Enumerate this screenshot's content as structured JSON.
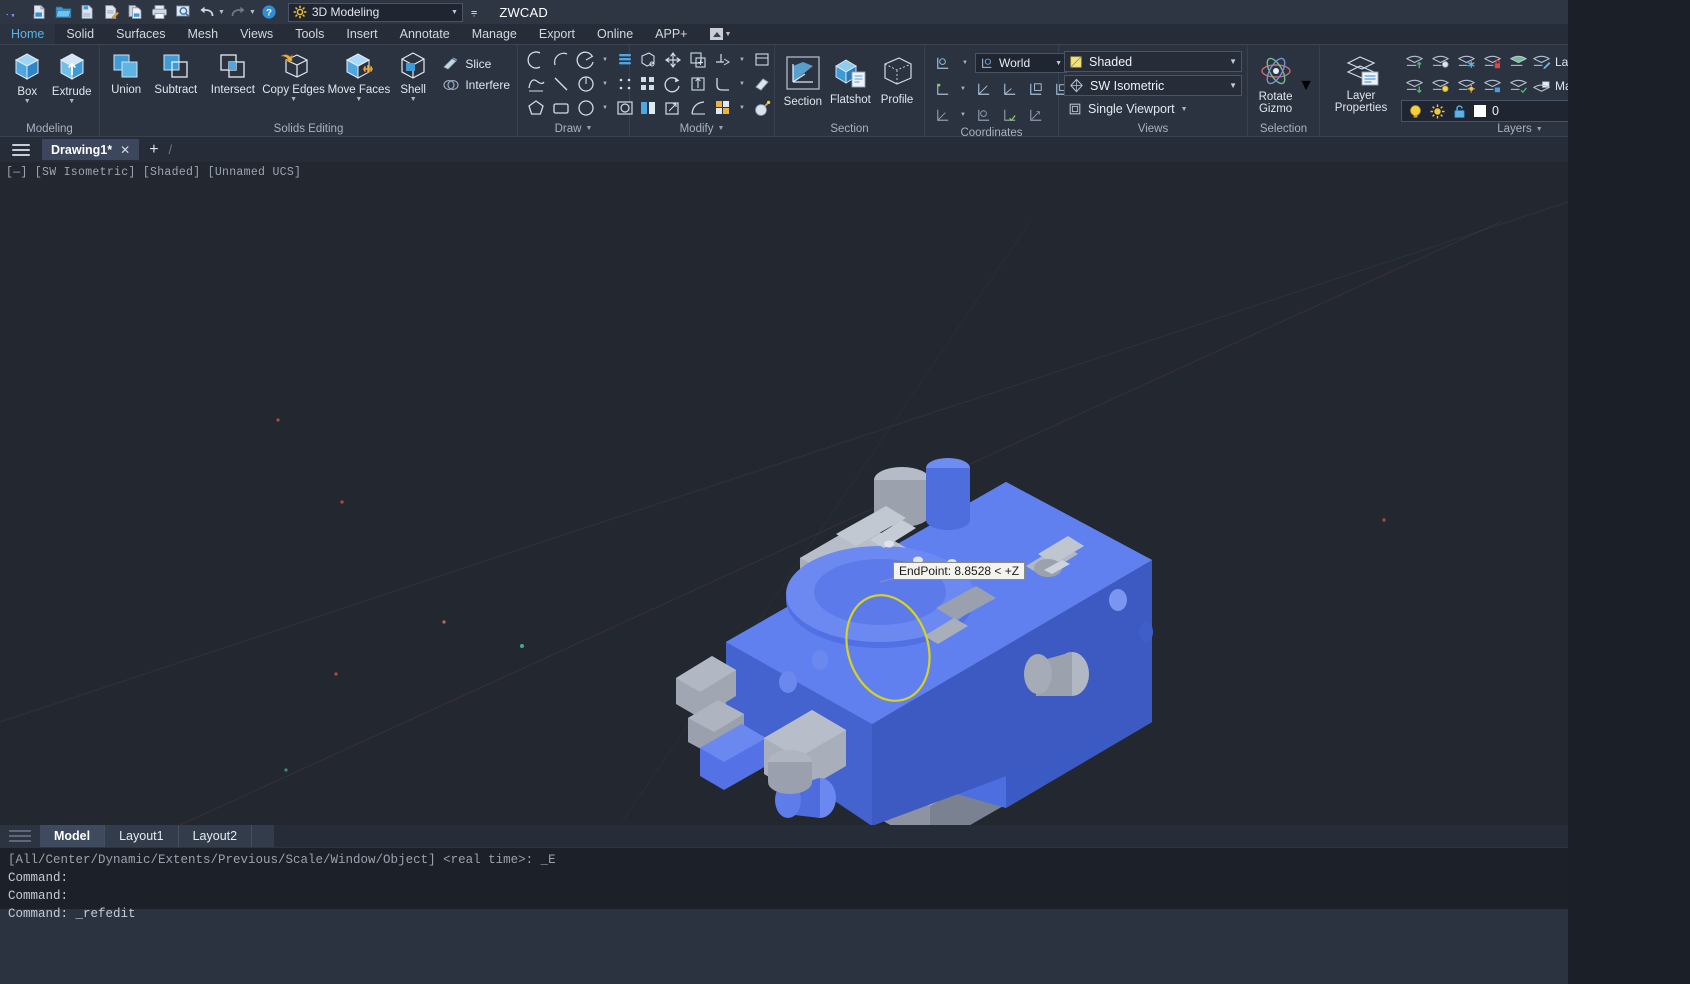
{
  "app": {
    "title": "ZWCAD",
    "workspace": "3D Modeling"
  },
  "quick_access": {
    "icons": [
      {
        "name": "zwcad-logo-icon",
        "glyph": "logo"
      },
      {
        "name": "new-file-icon",
        "glyph": "new"
      },
      {
        "name": "open-file-icon",
        "glyph": "open"
      },
      {
        "name": "save-file-icon",
        "glyph": "save"
      },
      {
        "name": "save-as-icon",
        "glyph": "saveas"
      },
      {
        "name": "plot-preview-icon",
        "glyph": "copy"
      },
      {
        "name": "print-icon",
        "glyph": "print"
      },
      {
        "name": "print-preview-icon",
        "glyph": "preview"
      },
      {
        "name": "undo-icon",
        "glyph": "undo"
      },
      {
        "name": "redo-icon",
        "glyph": "redo"
      },
      {
        "name": "help-icon",
        "glyph": "help"
      }
    ],
    "workspace_caret": "▼",
    "more_caret": "⩭"
  },
  "ribbon_tabs": [
    {
      "label": "Home",
      "active": true
    },
    {
      "label": "Solid",
      "active": false
    },
    {
      "label": "Surfaces",
      "active": false
    },
    {
      "label": "Mesh",
      "active": false
    },
    {
      "label": "Views",
      "active": false
    },
    {
      "label": "Tools",
      "active": false
    },
    {
      "label": "Insert",
      "active": false
    },
    {
      "label": "Annotate",
      "active": false
    },
    {
      "label": "Manage",
      "active": false
    },
    {
      "label": "Export",
      "active": false
    },
    {
      "label": "Online",
      "active": false
    },
    {
      "label": "APP+",
      "active": false
    }
  ],
  "panels": {
    "modeling": {
      "title": "Modeling",
      "buttons": [
        {
          "label": "Box",
          "dropdown": "▼"
        },
        {
          "label": "Extrude",
          "dropdown": "▼"
        }
      ]
    },
    "solids_editing": {
      "title": "Solids Editing",
      "buttons": [
        {
          "label": "Union",
          "dropdown": ""
        },
        {
          "label": "Subtract",
          "dropdown": ""
        },
        {
          "label": "Intersect",
          "dropdown": ""
        },
        {
          "label": "Copy Edges",
          "dropdown": "▼"
        },
        {
          "label": "Move Faces",
          "dropdown": "▼"
        },
        {
          "label": "Shell",
          "dropdown": "▼"
        }
      ],
      "small_buttons": [
        {
          "label": "Slice"
        },
        {
          "label": "Interfere"
        }
      ]
    },
    "draw": {
      "title": "Draw",
      "dropdown": "▼"
    },
    "modify": {
      "title": "Modify",
      "dropdown": "▼"
    },
    "section": {
      "title": "Section",
      "buttons": [
        {
          "label": "Section"
        },
        {
          "label": "Flatshot"
        },
        {
          "label": "Profile"
        }
      ]
    },
    "coordinates": {
      "title": "Coordinates",
      "ucs_value": "World",
      "caret": "▼"
    },
    "views": {
      "title": "Views",
      "visual_style": "Shaded",
      "view_preset": "SW Isometric",
      "viewport_config": "Single Viewport",
      "caret": "▼"
    },
    "selection": {
      "title": "Selection",
      "rotate_gizmo_label_1": "Rotate",
      "rotate_gizmo_label_2": "Gizmo",
      "dropdown": "▼"
    },
    "layers": {
      "title": "Layers",
      "dropdown": "▼",
      "layer_properties_label_1": "Layer",
      "layer_properties_label_2": "Properties",
      "row_labels": [
        "Layer Match",
        "Make Current"
      ],
      "current_layer": "0",
      "current_layer_caret": "▼"
    }
  },
  "file_tabs": {
    "menu_icon": "hamburger-icon",
    "tabs": [
      {
        "label": "Drawing1*",
        "close": "✕",
        "active": true
      }
    ],
    "add_label": "+",
    "separator": "/"
  },
  "viewport": {
    "label": "[—] [SW Isometric] [Shaded] [Unnamed UCS]",
    "tooltip": "EndPoint: 8.8528 < +Z",
    "background_color": "#23272f",
    "model_body_color": "#4f6fe0",
    "model_accent_color": "#9aa0ab",
    "highlight_ellipse_color": "#d4d223"
  },
  "layout_tabs": {
    "tabs": [
      {
        "label": "Model",
        "active": true
      },
      {
        "label": "Layout1",
        "active": false
      },
      {
        "label": "Layout2",
        "active": false
      }
    ]
  },
  "command_window": {
    "lines": [
      "[All/Center/Dynamic/Extents/Previous/Scale/Window/Object] <real time>: _E",
      "Command:",
      "Command:",
      "Command: _refedit"
    ]
  }
}
